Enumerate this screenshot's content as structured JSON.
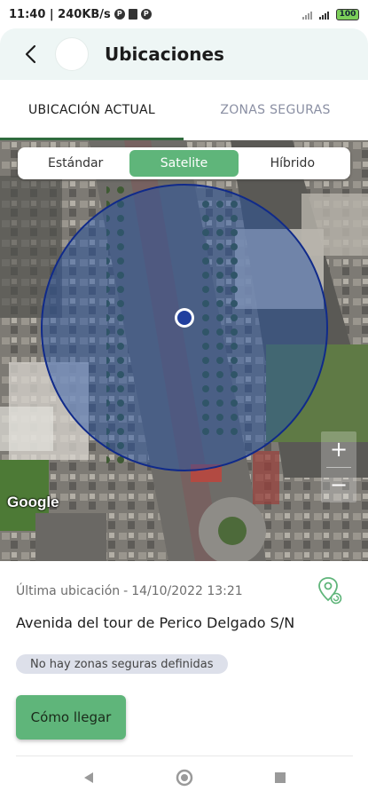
{
  "status_bar": {
    "time_speed": "11:40 | 240KB/s",
    "battery": "100"
  },
  "header": {
    "title": "Ubicaciones"
  },
  "tabs": [
    {
      "label": "UBICACIÓN ACTUAL",
      "active": true
    },
    {
      "label": "ZONAS SEGURAS",
      "active": false
    }
  ],
  "map": {
    "types": [
      {
        "label": "Estándar",
        "selected": false
      },
      {
        "label": "Satelite",
        "selected": true
      },
      {
        "label": "Híbrido",
        "selected": false
      }
    ],
    "zoom_in": "+",
    "zoom_out": "−",
    "attribution": "Google"
  },
  "info": {
    "last_location_label": "Última ubicación",
    "separator": "-",
    "datetime": "14/10/2022 13:21",
    "address": "Avenida del tour de Perico Delgado S/N",
    "zones_badge": "No hay zonas seguras definidas",
    "directions_button": "Cómo llegar"
  },
  "colors": {
    "accent_green": "#5fb57a",
    "tab_indicator": "#2f6b3d",
    "radius_circle": "#1f4fa8"
  }
}
